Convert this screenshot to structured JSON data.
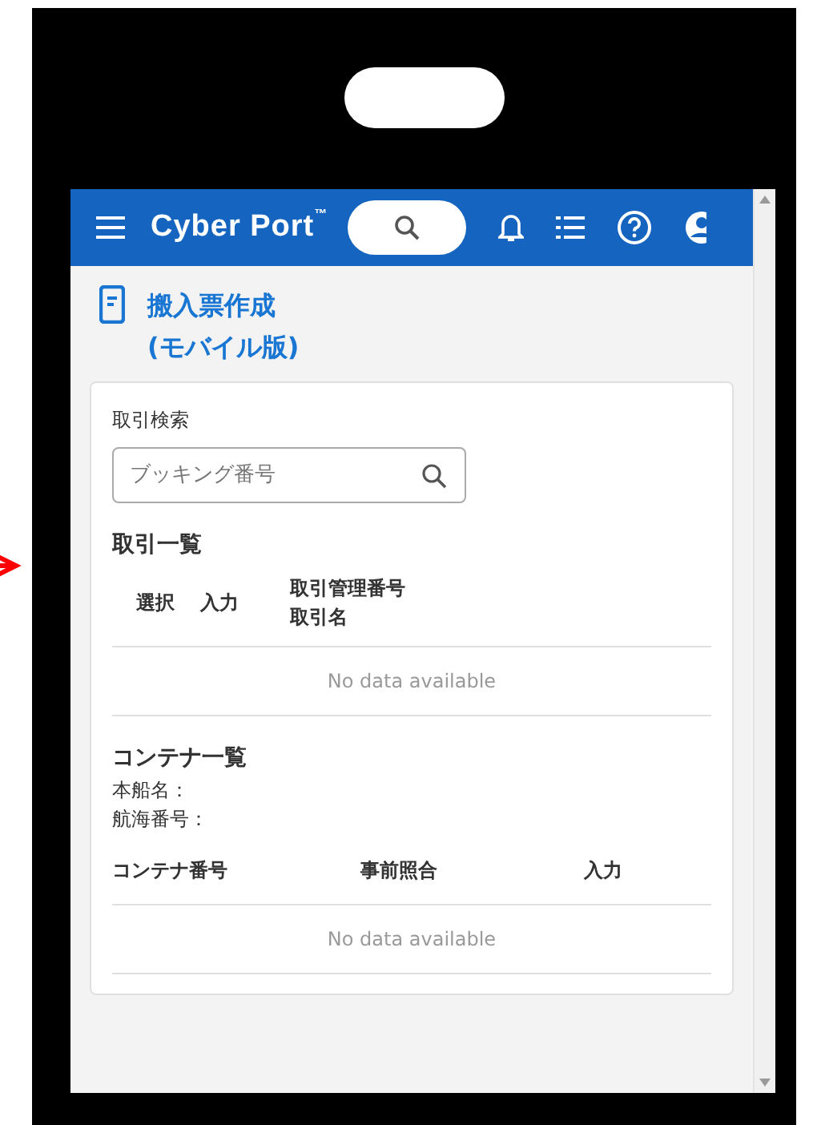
{
  "header": {
    "logo": "Cyber Port",
    "logo_mark": "™"
  },
  "page_title": [
    "搬入票作成",
    "(モバイル版)"
  ],
  "deal_search": {
    "label": "取引検索",
    "placeholder": "ブッキング番号"
  },
  "deal_list": {
    "title": "取引一覧",
    "columns": [
      [
        "選択"
      ],
      [
        "入力"
      ],
      [
        "取引管理番号",
        "取引名"
      ]
    ],
    "empty": "No data available"
  },
  "container_list": {
    "title": "コンテナ一覧",
    "fields": [
      "本船名：",
      "航海番号："
    ],
    "columns": [
      "コンテナ番号",
      "事前照合",
      "入力"
    ],
    "empty": "No data available"
  }
}
